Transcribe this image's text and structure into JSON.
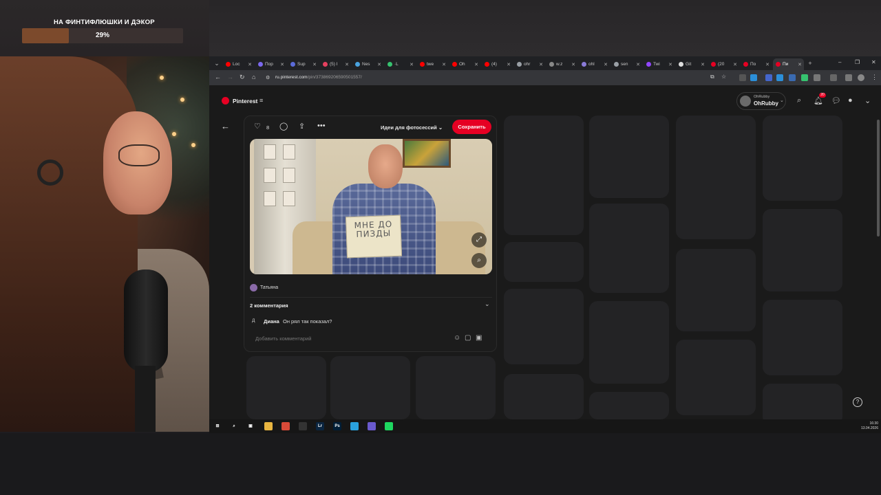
{
  "overlay": {
    "goal_title": "НА ФИНТИФЛЮШКИ И ДЭКОР",
    "goal_percent": "29%",
    "goal_progress": 0.29
  },
  "browser": {
    "tabs": [
      {
        "label": "Loc",
        "color": "#ff0000"
      },
      {
        "label": "Пор",
        "color": "#7b68ee"
      },
      {
        "label": "Sup",
        "color": "#5b6bd8"
      },
      {
        "label": "(5) I",
        "color": "#e4405f"
      },
      {
        "label": "Nes",
        "color": "#4aa3df"
      },
      {
        "label": "·L",
        "color": "#36c26f"
      },
      {
        "label": "twe",
        "color": "#ff0000"
      },
      {
        "label": "Oh",
        "color": "#ff0000"
      },
      {
        "label": "(4)",
        "color": "#ff0000"
      },
      {
        "label": "ohr",
        "color": "#9aa0a6"
      },
      {
        "label": "w.z",
        "color": "#888888"
      },
      {
        "label": "ohl",
        "color": "#8a7bd8"
      },
      {
        "label": "sen",
        "color": "#9aa0a6"
      },
      {
        "label": "Twi",
        "color": "#9146ff"
      },
      {
        "label": "Git",
        "color": "#dddddd"
      },
      {
        "label": "(20",
        "color": "#e60023"
      },
      {
        "label": "По",
        "color": "#e60023"
      },
      {
        "label": "Пи",
        "color": "#e60023"
      }
    ],
    "active_tab_index": 17,
    "url_host": "ru.pinterest.com",
    "url_path": "/pin/373869206590501557/"
  },
  "pinterest": {
    "brand": "Pinterest",
    "account_small": "OhRubby",
    "account_name": "OhRubby",
    "notifications_count": "20",
    "like_count": "8",
    "board_label": "Идеи для фотосессий",
    "save_label": "Сохранить",
    "sign_text": "МНЕ ДО ПИЗДЫ",
    "author": "Татьяна",
    "comments_count_label": "2 комментария",
    "comment": {
      "avatar_letter": "Д",
      "author": "Диана",
      "text": "Он рял так показал?"
    },
    "comment_placeholder": "Добавить комментарий"
  },
  "taskbar": {
    "apps": [
      {
        "name": "windows-start-icon",
        "label": "⊞",
        "color": "#161616"
      },
      {
        "name": "search-icon",
        "label": "⌕",
        "color": "#161616"
      },
      {
        "name": "task-view-icon",
        "label": "▣",
        "color": "#161616"
      },
      {
        "name": "explorer-icon",
        "label": "",
        "color": "#e8b540"
      },
      {
        "name": "chrome-icon",
        "label": "",
        "color": "#d84a38"
      },
      {
        "name": "obs-icon",
        "label": "",
        "color": "#333333"
      },
      {
        "name": "lightroom-icon",
        "label": "Lr",
        "color": "#0a2540"
      },
      {
        "name": "photoshop-icon",
        "label": "Ps",
        "color": "#001e36"
      },
      {
        "name": "telegram-icon",
        "label": "",
        "color": "#2aa1de"
      },
      {
        "name": "grid-app-icon",
        "label": "",
        "color": "#6a5acd"
      },
      {
        "name": "spotify-icon",
        "label": "",
        "color": "#1ed760"
      }
    ],
    "time": "16:30",
    "date": "13.04.2026"
  }
}
